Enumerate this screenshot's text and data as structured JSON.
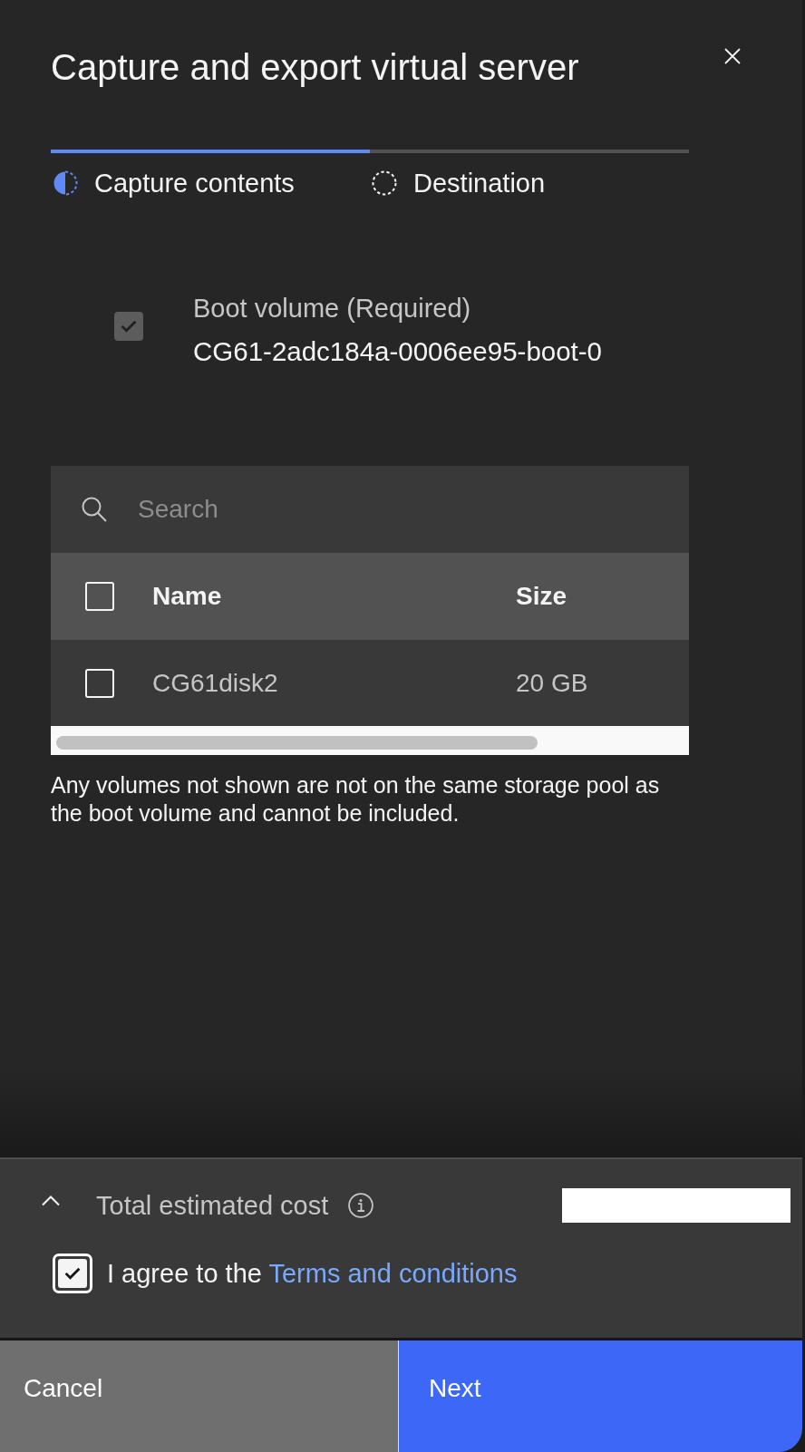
{
  "title": "Capture and export virtual server",
  "progress_steps": [
    {
      "label": "Capture contents",
      "current": true,
      "complete": false
    },
    {
      "label": "Destination",
      "current": false,
      "complete": false
    }
  ],
  "boot_volume": {
    "label": "Boot volume (Required)",
    "name": "CG61-2adc184a-0006ee95-boot-0",
    "checked": true,
    "disabled": true
  },
  "volume_table": {
    "search": {
      "placeholder": "Search"
    },
    "select_all_checked": false,
    "columns": [
      "Name",
      "Size"
    ],
    "rows": [
      {
        "cells": [
          "CG61disk2",
          "20 GB"
        ],
        "selected": false
      }
    ]
  },
  "note": "Any volumes not shown are not on the same storage pool as the boot volume and cannot be included.",
  "footer": {
    "cost": {
      "label": "Total estimated cost",
      "expanded": false,
      "value_redacted": true
    },
    "agreement": {
      "text": "I agree to the ",
      "link": "Terms and conditions",
      "checked": true,
      "focused": true
    }
  },
  "buttons": [
    {
      "label": "Cancel",
      "kind": "secondary"
    },
    {
      "label": "Next",
      "kind": "primary"
    }
  ]
}
